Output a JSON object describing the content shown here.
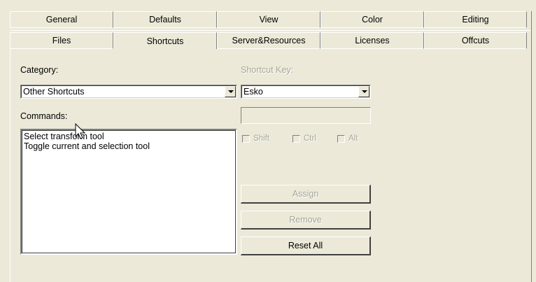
{
  "tabs_row1": [
    "General",
    "Defaults",
    "View",
    "Color",
    "Editing"
  ],
  "tabs_row2": [
    "Files",
    "Shortcuts",
    "Server&Resources",
    "Licenses",
    "Offcuts"
  ],
  "selected_tab": "Shortcuts",
  "category": {
    "label": "Category:",
    "value": "Other Shortcuts"
  },
  "commands": {
    "label": "Commands:",
    "items": [
      "Select transform tool",
      "Toggle current and selection tool"
    ]
  },
  "shortcut": {
    "label": "Shortcut Key:",
    "scheme_value": "Esko",
    "key_value": ""
  },
  "modifiers": [
    "Shift",
    "Ctrl",
    "Alt"
  ],
  "buttons": {
    "assign": "Assign",
    "remove": "Remove",
    "reset_all": "Reset All"
  },
  "icons": {
    "cursor": "arrow-cursor-icon",
    "dropdown": "chevron-down-icon"
  }
}
